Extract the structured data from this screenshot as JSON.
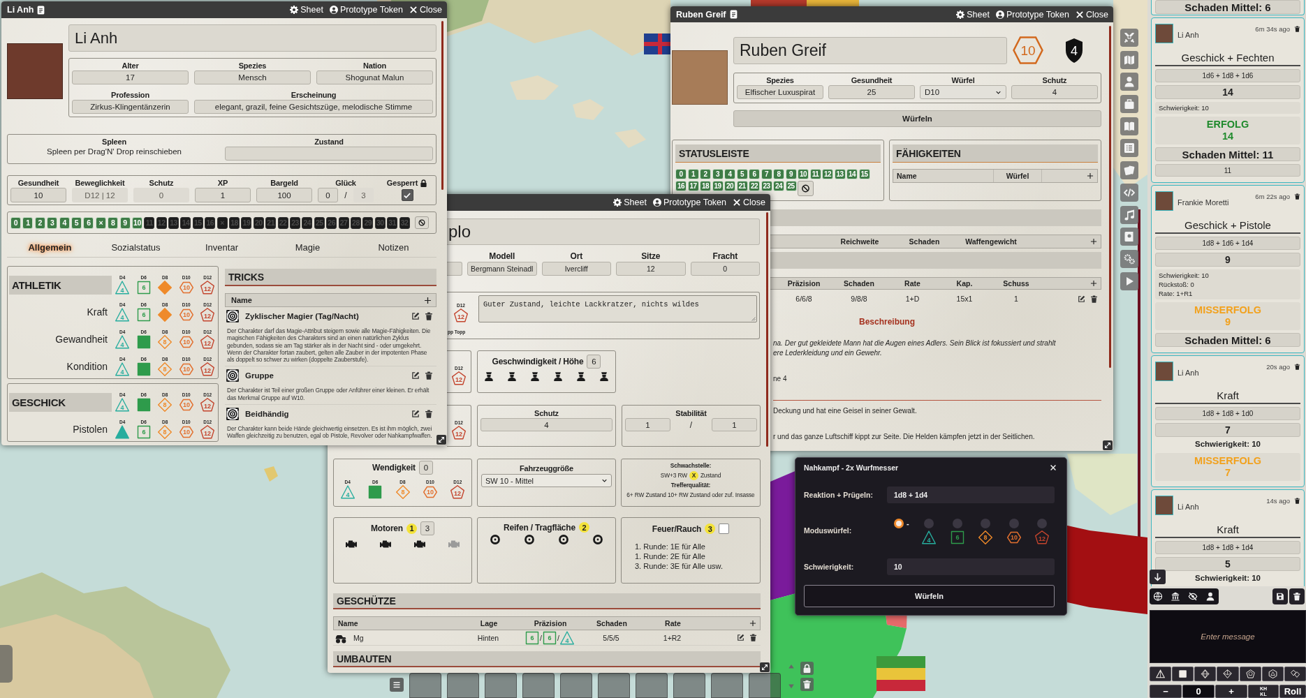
{
  "li_anh": {
    "window": {
      "title": "Li Anh",
      "actions": [
        {
          "kind": "sheet",
          "label": "Sheet"
        },
        {
          "kind": "token",
          "label": "Prototype Token"
        },
        {
          "kind": "close",
          "label": "Close"
        }
      ]
    },
    "name": "Li Anh",
    "details": [
      [
        {
          "label": "Alter",
          "value": "17"
        },
        {
          "label": "Spezies",
          "value": "Mensch"
        },
        {
          "label": "Nation",
          "value": "Shogunat Malun"
        }
      ],
      [
        {
          "label": "Profession",
          "value": "Zirkus-Klingentänzerin"
        },
        {
          "label": "Erscheinung",
          "value": "elegant, grazil, feine Gesichtszüge, melodische Stimme"
        }
      ]
    ],
    "spleen": {
      "label": "Spleen",
      "hint": "Spleen per Drag'N' Drop reinschieben"
    },
    "condition": {
      "label": "Zustand"
    },
    "stats": [
      {
        "label": "Gesundheit",
        "value": "10",
        "disabled": false
      },
      {
        "label": "Beweglichkeit",
        "value": "D12 | 12",
        "disabled": true
      },
      {
        "label": "Schutz",
        "value": "0",
        "disabled": true
      },
      {
        "label": "XP",
        "value": "1",
        "disabled": false
      },
      {
        "label": "Bargeld",
        "value": "100",
        "disabled": false
      }
    ],
    "luck": {
      "label": "Glück",
      "value": "0",
      "separator": "/",
      "max": "3",
      "max_disabled": true
    },
    "locked": {
      "label": "Gesperrt",
      "checked": true
    },
    "pips": [
      {
        "label": "0",
        "on": true
      },
      {
        "label": "1",
        "on": true
      },
      {
        "label": "2",
        "on": true
      },
      {
        "label": "3",
        "on": true
      },
      {
        "label": "4",
        "on": true
      },
      {
        "label": "5",
        "on": true
      },
      {
        "label": "6",
        "on": true
      },
      {
        "label": "×",
        "on": true
      },
      {
        "label": "8",
        "on": true
      },
      {
        "label": "9",
        "on": true
      },
      {
        "label": "10",
        "on": true
      },
      {
        "label": "11",
        "on": false
      },
      {
        "label": "12",
        "on": false
      },
      {
        "label": "13",
        "on": false
      },
      {
        "label": "14",
        "on": false
      },
      {
        "label": "15",
        "on": false
      },
      {
        "label": "16",
        "on": false
      },
      {
        "label": "×",
        "on": false
      },
      {
        "label": "18",
        "on": false
      },
      {
        "label": "19",
        "on": false
      },
      {
        "label": "20",
        "on": false
      },
      {
        "label": "21",
        "on": false
      },
      {
        "label": "22",
        "on": false
      },
      {
        "label": "23",
        "on": false
      },
      {
        "label": "24",
        "on": false
      },
      {
        "label": "25",
        "on": false
      },
      {
        "label": "26",
        "on": false
      },
      {
        "label": "27",
        "on": false
      },
      {
        "label": "28",
        "on": false
      },
      {
        "label": "29",
        "on": false
      },
      {
        "label": "30",
        "on": false
      },
      {
        "label": "31",
        "on": false
      },
      {
        "label": "32",
        "on": false
      }
    ],
    "tabs": [
      {
        "label": "Allgemein",
        "selected": true
      },
      {
        "label": "Sozialstatus",
        "selected": false
      },
      {
        "label": "Inventar",
        "selected": false
      },
      {
        "label": "Magie",
        "selected": false
      },
      {
        "label": "Notizen",
        "selected": false
      }
    ],
    "attributes": [
      {
        "name": "ATHLETIK",
        "dice": [
          {
            "kind": "d4",
            "label": "D4",
            "face": "4",
            "selected": false
          },
          {
            "kind": "d6",
            "label": "D6",
            "face": "6",
            "selected": false
          },
          {
            "kind": "d8",
            "label": "D8",
            "selected": true
          },
          {
            "kind": "d10",
            "label": "D10",
            "face": "10",
            "selected": false
          },
          {
            "kind": "d12",
            "label": "D12",
            "face": "12",
            "selected": false
          }
        ],
        "skills": [
          {
            "name": "Kraft",
            "dice": [
              {
                "kind": "d4",
                "label": "D4",
                "face": "4",
                "selected": false
              },
              {
                "kind": "d6",
                "label": "D6",
                "face": "6",
                "selected": false
              },
              {
                "kind": "d8",
                "label": "D8",
                "selected": true
              },
              {
                "kind": "d10",
                "label": "D10",
                "face": "10",
                "selected": false
              },
              {
                "kind": "d12",
                "label": "D12",
                "face": "12",
                "selected": false
              }
            ]
          },
          {
            "name": "Gewandheit",
            "dice": [
              {
                "kind": "d4",
                "label": "D4",
                "face": "4",
                "selected": false
              },
              {
                "kind": "d6",
                "label": "D6",
                "selected": true
              },
              {
                "kind": "d8",
                "label": "D8",
                "face": "8",
                "selected": false
              },
              {
                "kind": "d10",
                "label": "D10",
                "face": "10",
                "selected": false
              },
              {
                "kind": "d12",
                "label": "D12",
                "face": "12",
                "selected": false
              }
            ]
          },
          {
            "name": "Kondition",
            "dice": [
              {
                "kind": "d4",
                "label": "D4",
                "face": "4",
                "selected": false
              },
              {
                "kind": "d6",
                "label": "D6",
                "selected": true
              },
              {
                "kind": "d8",
                "label": "D8",
                "face": "8",
                "selected": false
              },
              {
                "kind": "d10",
                "label": "D10",
                "face": "10",
                "selected": false
              },
              {
                "kind": "d12",
                "label": "D12",
                "face": "12",
                "selected": false
              }
            ]
          }
        ]
      },
      {
        "name": "GESCHICK",
        "dice": [
          {
            "kind": "d4",
            "label": "D4",
            "face": "4",
            "selected": false
          },
          {
            "kind": "d6",
            "label": "D6",
            "selected": true
          },
          {
            "kind": "d8",
            "label": "D8",
            "face": "8",
            "selected": false
          },
          {
            "kind": "d10",
            "label": "D10",
            "face": "10",
            "selected": false
          },
          {
            "kind": "d12",
            "label": "D12",
            "face": "12",
            "selected": false
          }
        ],
        "skills": [
          {
            "name": "Pistolen",
            "dice": [
              {
                "kind": "d4",
                "label": "D4",
                "selected": true
              },
              {
                "kind": "d6",
                "label": "D6",
                "face": "6",
                "selected": false
              },
              {
                "kind": "d8",
                "label": "D8",
                "face": "8",
                "selected": false
              },
              {
                "kind": "d10",
                "label": "D10",
                "face": "10",
                "selected": false
              },
              {
                "kind": "d12",
                "label": "D12",
                "face": "12",
                "selected": false
              }
            ]
          }
        ]
      }
    ],
    "tricks": {
      "title": "TRICKS",
      "column": "Name",
      "items": [
        {
          "name": "Zyklischer Magier (Tag/Nacht)",
          "description": "Der Charakter darf das Magie-Attribut steigern sowie alle Magie-Fähigkeiten. Die magischen Fähigkeiten des Charakters sind an einen natürlichen Zyklus gebunden, sodass sie am Tag stärker als in der Nacht sind - oder umgekehrt. Wenn der Charakter fortan zaubert, gelten alle Zauber in der impotenten Phase als doppelt so schwer zu wirken (doppelte Zauberstufe)."
        },
        {
          "name": "Gruppe",
          "description": "Der Charakter ist Teil einer großen Gruppe oder Anführer einer kleinen. Er erhält das Merkmal Gruppe auf W10."
        },
        {
          "name": "Beidhändig",
          "description": "Der Charakter kann beide Hände gleichwertig einsetzen. Es ist ihm möglich, zwei Waffen gleichzeitig zu benutzen, egal ob Pistole, Revolver oder Nahkampfwaffen."
        }
      ]
    }
  },
  "vehicle": {
    "window": {
      "actions": [
        {
          "kind": "sheet",
          "label": "Sheet"
        },
        {
          "kind": "token",
          "label": "Prototype Token"
        },
        {
          "kind": "close",
          "label": "Close"
        }
      ]
    },
    "name": "plo",
    "fields": [
      {
        "label": "Modell",
        "value": "Bergmann Steinadl"
      },
      {
        "label": "Ort",
        "value": "Ivercliff"
      },
      {
        "label": "Sitze",
        "value": "12"
      },
      {
        "label": "Fracht",
        "value": "0"
      }
    ],
    "condition_die": {
      "kind": "d12",
      "label": "D12",
      "face": "12",
      "note": "pp Topp"
    },
    "notes": "Guter Zustand, leichte Lackkratzer, nichts wildes",
    "speed": {
      "die": {
        "kind": "d12",
        "label": "D12",
        "face": "12"
      },
      "label": "Geschwindigkeit / Höhe",
      "value": "6",
      "crew": [
        {
          "active": true
        },
        {
          "active": true
        },
        {
          "active": true
        },
        {
          "active": true
        },
        {
          "active": true
        },
        {
          "active": true
        }
      ]
    },
    "armor": {
      "die": {
        "kind": "d12",
        "label": "D12",
        "face": "12"
      },
      "label": "Schutz",
      "value": "4"
    },
    "stability": {
      "label": "Stabilität",
      "value": "1",
      "separator": "/",
      "max": "1"
    },
    "agility": {
      "label": "Wendigkeit",
      "value": "0",
      "dice": [
        {
          "kind": "d4",
          "label": "D4",
          "face": "4",
          "selected": false
        },
        {
          "kind": "d6",
          "label": "D6",
          "selected": true
        },
        {
          "kind": "d8",
          "label": "D8",
          "face": "8",
          "selected": false
        },
        {
          "kind": "d10",
          "label": "D10",
          "face": "10",
          "selected": false
        },
        {
          "kind": "d12",
          "label": "D12",
          "face": "12",
          "selected": false
        }
      ]
    },
    "size": {
      "label": "Fahrzeuggröße",
      "value": "SW 10 - Mittel"
    },
    "weak_spot": {
      "label": "Schwachstelle:",
      "before": "SW+3 RW",
      "marker": "X",
      "after": "Zustand",
      "quality_label": "Trefferqualität:",
      "quality": "6+ RW Zustand 10+ RW Zustand oder zuf. Insasse"
    },
    "engines": {
      "label": "Motoren",
      "marker": "1",
      "value": "3",
      "items": [
        {
          "active": true
        },
        {
          "active": true
        },
        {
          "active": true
        },
        {
          "active": false
        }
      ]
    },
    "tires": {
      "label": "Reifen / Tragfläche",
      "marker": "2",
      "items": [
        {
          "active": true
        },
        {
          "active": true
        },
        {
          "active": true
        },
        {
          "active": true
        }
      ]
    },
    "fire": {
      "label": "Feuer/Rauch",
      "marker": "3",
      "checked": false,
      "rules": [
        "1. Runde: 1E für Alle",
        "1. Runde: 2E für Alle",
        "3. Runde: 3E für Alle usw."
      ]
    },
    "weapons": {
      "title": "GESCHÜTZE",
      "columns": [
        "Name",
        "Lage",
        "Präzision",
        "Schaden",
        "Rate"
      ],
      "rows": [
        {
          "name": "Mg",
          "position": "Hinten",
          "precision": [
            {
              "kind": "d6",
              "face": "6",
              "sep": "/"
            },
            {
              "kind": "d6",
              "face": "6",
              "sep": "/"
            },
            {
              "kind": "d4",
              "face": "4"
            }
          ],
          "damage": "5/5/5",
          "rate": "1+R2"
        }
      ]
    },
    "mods": {
      "title": "UMBAUTEN"
    }
  },
  "ruben": {
    "window": {
      "title": "Ruben Greif",
      "actions": [
        {
          "kind": "sheet",
          "label": "Sheet"
        },
        {
          "kind": "token",
          "label": "Prototype Token"
        },
        {
          "kind": "close",
          "label": "Close"
        }
      ]
    },
    "name": "Ruben Greif",
    "hex_badge": "10",
    "shield_badge": "4",
    "stats": [
      {
        "kind": "text",
        "label": "Spezies",
        "value": "Elfischer Luxuspirat"
      },
      {
        "kind": "text",
        "label": "Gesundheit",
        "value": "25"
      },
      {
        "kind": "select",
        "label": "Würfel",
        "value": "D10"
      },
      {
        "kind": "text",
        "label": "Schutz",
        "value": "4"
      }
    ],
    "roll": "Würfeln",
    "status": {
      "title": "STATUSLEISTE",
      "pips": [
        {
          "label": "0",
          "on": true
        },
        {
          "label": "1",
          "on": true
        },
        {
          "label": "2",
          "on": true
        },
        {
          "label": "3",
          "on": true
        },
        {
          "label": "4",
          "on": true
        },
        {
          "label": "5",
          "on": true
        },
        {
          "label": "6",
          "on": true
        },
        {
          "label": "7",
          "on": true
        },
        {
          "label": "8",
          "on": true
        },
        {
          "label": "9",
          "on": true
        },
        {
          "label": "10",
          "on": true
        },
        {
          "label": "11",
          "on": true
        },
        {
          "label": "12",
          "on": true
        },
        {
          "label": "13",
          "on": true
        },
        {
          "label": "14",
          "on": true
        },
        {
          "label": "15",
          "on": true
        },
        {
          "label": "16",
          "on": true
        },
        {
          "label": "17",
          "on": true
        },
        {
          "label": "18",
          "on": true
        },
        {
          "label": "19",
          "on": true
        },
        {
          "label": "20",
          "on": true
        },
        {
          "label": "21",
          "on": true
        },
        {
          "label": "22",
          "on": true
        },
        {
          "label": "23",
          "on": true
        },
        {
          "label": "24",
          "on": true
        },
        {
          "label": "25",
          "on": true
        }
      ]
    },
    "abilities": {
      "title": "FÄHIGKEITEN",
      "columns": [
        "Name",
        "Würfel"
      ]
    },
    "melee": {
      "columns": [
        "Reichweite",
        "Schaden",
        "Waffengewicht"
      ]
    },
    "ranged": {
      "columns": [
        "Präzision",
        "Schaden",
        "Rate",
        "Kap.",
        "Schuss"
      ],
      "rows": [
        [
          "6/6/8",
          "9/8/8",
          "1+D",
          "15x1",
          "1"
        ]
      ]
    },
    "description": {
      "title": "Beschreibung",
      "paragraphs": [
        {
          "italic": true,
          "rule": false,
          "lines": [
            "na. Der gut gekleidete Mann hat die Augen eines Adlers. Sein Blick ist fokussiert und strahlt",
            "ere Lederkleidung und ein Gewehr."
          ]
        },
        {
          "italic": false,
          "rule": false,
          "lines": [
            "ne 4"
          ]
        },
        {
          "italic": false,
          "rule": true,
          "lines": [
            "Deckung und hat eine Geisel in seiner Gewalt."
          ]
        },
        {
          "italic": false,
          "rule": false,
          "lines": [
            "r und das ganze Luftschiff kippt zur Seite. Die Helden kämpfen jetzt in der Seitlichen."
          ]
        }
      ]
    }
  },
  "roll_dialog": {
    "title": "Nahkampf - 2x Wurfmesser",
    "rows": [
      {
        "kind": "field",
        "label": "Reaktion + Prügeln:",
        "value": "1d8 + 1d4"
      },
      {
        "kind": "modes",
        "label": "Moduswürfel:",
        "options": [
          {
            "kind": "none",
            "label": "-",
            "selected": true
          },
          {
            "kind": "d4",
            "face": "4",
            "selected": false
          },
          {
            "kind": "d6",
            "face": "6",
            "selected": false
          },
          {
            "kind": "d8",
            "face": "8",
            "selected": false
          },
          {
            "kind": "d10",
            "face": "10",
            "selected": false
          },
          {
            "kind": "d12",
            "face": "12",
            "selected": false
          }
        ]
      },
      {
        "kind": "field",
        "label": "Schwierigkeit:",
        "value": "10"
      }
    ],
    "button": "Würfeln"
  },
  "chat": {
    "messages": [
      {
        "blocks": [
          {
            "kind": "damage",
            "text": "Schaden Mittel: 6"
          }
        ]
      },
      {
        "name": "Li Anh",
        "time": "6m 34s ago",
        "title": "Geschick + Fechten",
        "blocks": [
          {
            "kind": "formula",
            "text": "1d6 + 1d8 + 1d6"
          },
          {
            "kind": "total",
            "text": "14"
          },
          {
            "kind": "info",
            "lines": [
              "Schwierigkeit: 10"
            ]
          },
          {
            "kind": "result",
            "color": "#1f8a2c",
            "label": "ERFOLG",
            "value": "14"
          },
          {
            "kind": "damage",
            "text": "Schaden Mittel: 11"
          },
          {
            "kind": "plain",
            "text": "11"
          }
        ]
      },
      {
        "name": "Frankie Moretti",
        "time": "6m 22s ago",
        "title": "Geschick + Pistole",
        "blocks": [
          {
            "kind": "formula",
            "text": "1d8 + 1d6 + 1d4"
          },
          {
            "kind": "total",
            "text": "9"
          },
          {
            "kind": "info",
            "lines": [
              "Schwierigkeit: 10",
              "Rückstoß: 0",
              "Rate: 1+R1"
            ]
          },
          {
            "kind": "result",
            "color": "#f2a11c",
            "label": "MISSERFOLG",
            "value": "9"
          },
          {
            "kind": "damage",
            "text": "Schaden Mittel: 6"
          }
        ]
      },
      {
        "name": "Li Anh",
        "time": "20s ago",
        "title": "Kraft",
        "blocks": [
          {
            "kind": "formula",
            "text": "1d8 + 1d8 + 1d0"
          },
          {
            "kind": "total",
            "text": "7"
          },
          {
            "kind": "difficulty",
            "text": "Schwierigkeit: 10"
          },
          {
            "kind": "result",
            "color": "#f2a11c",
            "label": "MISSERFOLG",
            "value": "7"
          }
        ]
      },
      {
        "name": "Li Anh",
        "time": "14s ago",
        "title": "Kraft",
        "blocks": [
          {
            "kind": "formula",
            "text": "1d8 + 1d8 + 1d4"
          },
          {
            "kind": "total",
            "text": "5"
          },
          {
            "kind": "difficulty",
            "text": "Schwierigkeit: 10"
          }
        ]
      }
    ],
    "input": {
      "placeholder": "Enter message"
    },
    "roller": {
      "decrement": "−",
      "modifier": "0",
      "increment": "+",
      "keep": [
        "KH",
        "KL"
      ],
      "roll": "Roll"
    }
  }
}
